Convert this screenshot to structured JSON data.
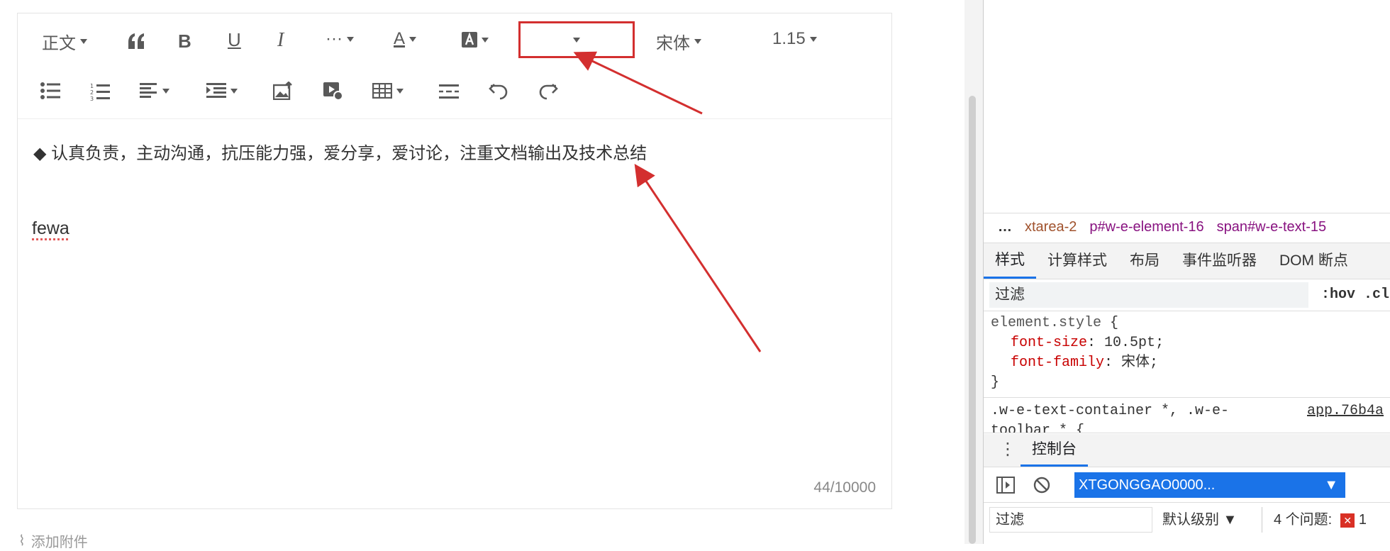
{
  "toolbar": {
    "heading_label": "正文",
    "more_label": "···",
    "font_family_label": "宋体",
    "line_height_label": "1.15"
  },
  "content": {
    "line1": "◆ 认真负责，主动沟通，抗压能力强，爱分享，爱讨论，注重文档输出及技术总结",
    "line2": "fewa",
    "counter": "44/10000"
  },
  "attach_label": "添加附件",
  "devtools": {
    "breadcrumb": [
      "xtarea-2",
      "p#w-e-element-16",
      "span#w-e-text-15"
    ],
    "tabs": [
      "样式",
      "计算样式",
      "布局",
      "事件监听器",
      "DOM 断点"
    ],
    "filter_placeholder": "过滤",
    "hov_label": ":hov .cls",
    "element_style": {
      "selector": "element.style",
      "prop1": "font-size",
      "val1": "10.5pt",
      "prop2": "font-family",
      "val2": "宋体"
    },
    "rule2_selector": ".w-e-text-container *, .w-e-\ntoolbar * {",
    "rule2_source": "app.76b4a",
    "drawer_tab": "控制台",
    "context": "XTGONGGAO0000...",
    "console_filter": "过滤",
    "level": "默认级别 ▼",
    "issues": "4 个问题:",
    "issue_count": "1"
  },
  "colors": {
    "annotation": "#d32f2f",
    "accent": "#1a73e8"
  }
}
